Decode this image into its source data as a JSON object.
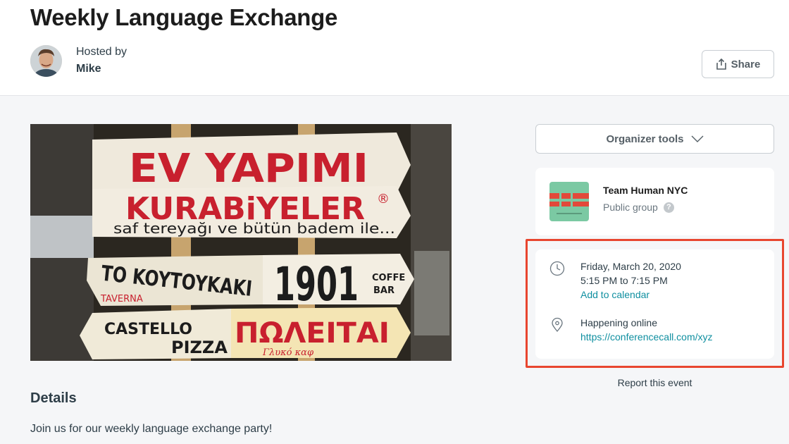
{
  "event": {
    "title": "Weekly Language Exchange",
    "hosted_by_label": "Hosted by",
    "host_name": "Mike"
  },
  "header": {
    "share_label": "Share",
    "share_icon": "share-icon"
  },
  "sidebar": {
    "organizer_tools_label": "Organizer tools",
    "organizer_tools_icon": "chevron-down-icon",
    "group": {
      "name": "Team Human NYC",
      "type": "Public group",
      "help_icon": "help-icon"
    },
    "date": "Friday, March 20, 2020",
    "time": "5:15 PM to 7:15 PM",
    "add_to_calendar": "Add to calendar",
    "location": "Happening online",
    "location_link": "https://conferencecall.com/xyz",
    "report_label": "Report this event"
  },
  "hero_image": {
    "sign_lines": [
      "EV YAPIMI",
      "KURABiYELER",
      "saf tereyağı ve bütün badem ile...",
      "TO KOYTOYKAKI",
      "1901",
      "COFFE",
      "BAR",
      "TAVERNA",
      "CASTELLO",
      "PIZZA",
      "ΠΩΛΕΙΤΑΙ",
      "Γλυκό καφ"
    ]
  },
  "details": {
    "heading": "Details",
    "text": "Join us for our weekly language exchange party!"
  },
  "colors": {
    "highlight": "#e8462f",
    "link": "#0f8fa0",
    "sign_red": "#c8202e"
  }
}
